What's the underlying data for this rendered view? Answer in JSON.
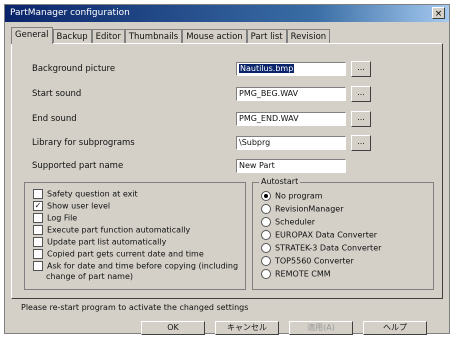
{
  "window": {
    "title": "PartManager configuration",
    "close_glyph": "×"
  },
  "tabs": [
    {
      "label": "General",
      "active": true
    },
    {
      "label": "Backup",
      "active": false
    },
    {
      "label": "Editor",
      "active": false
    },
    {
      "label": "Thumbnails",
      "active": false
    },
    {
      "label": "Mouse action",
      "active": false
    },
    {
      "label": "Part list",
      "active": false
    },
    {
      "label": "Revision",
      "active": false
    }
  ],
  "general": {
    "background_picture": {
      "label": "Background picture",
      "value": "Nautilus.bmp",
      "browse": "..."
    },
    "start_sound": {
      "label": "Start sound",
      "value": "PMG_BEG.WAV",
      "browse": "..."
    },
    "end_sound": {
      "label": "End sound",
      "value": "PMG_END.WAV",
      "browse": "..."
    },
    "library": {
      "label": "Library for subprograms",
      "value": "\\Subprg",
      "browse": "..."
    },
    "supported_part_name": {
      "label": "Supported part name",
      "value": "New Part"
    }
  },
  "options": [
    {
      "label": "Safety question at exit",
      "checked": false
    },
    {
      "label": "Show user level",
      "checked": true
    },
    {
      "label": "Log File",
      "checked": false
    },
    {
      "label": "Execute part function automatically",
      "checked": false
    },
    {
      "label": "Update part list automatically",
      "checked": false
    },
    {
      "label": "Copied part gets current date and time",
      "checked": false
    },
    {
      "label": "Ask for date and time before copying (including",
      "checked": false,
      "line2": "change of part name)"
    }
  ],
  "autostart": {
    "legend": "Autostart",
    "items": [
      {
        "label": "No program",
        "selected": true
      },
      {
        "label": "RevisionManager",
        "selected": false
      },
      {
        "label": "Scheduler",
        "selected": false
      },
      {
        "label": "EUROPAX Data Converter",
        "selected": false
      },
      {
        "label": "STRATEK-3 Data Converter",
        "selected": false
      },
      {
        "label": "TOP5560 Converter",
        "selected": false
      },
      {
        "label": "REMOTE CMM",
        "selected": false
      }
    ]
  },
  "status_text": "Please re-start program to activate the changed settings",
  "buttons": {
    "ok": "OK",
    "cancel": "キャンセル",
    "apply": "適用(A)",
    "help": "ヘルプ"
  }
}
